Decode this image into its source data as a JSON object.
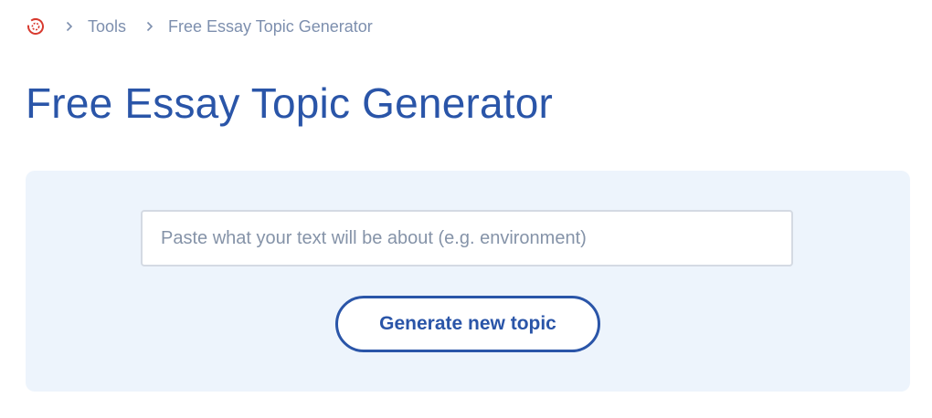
{
  "breadcrumb": {
    "home_icon": "home-logo-icon",
    "separator_icon": "chevron-right-icon",
    "items": [
      {
        "label": "Tools"
      },
      {
        "label": "Free Essay Topic Generator"
      }
    ]
  },
  "page": {
    "title": "Free Essay Topic Generator"
  },
  "form": {
    "input_placeholder": "Paste what your text will be about (e.g. environment)",
    "input_value": "",
    "button_label": "Generate new topic"
  },
  "colors": {
    "accent": "#2a55a8",
    "panel_background": "#edf4fc",
    "home_icon": "#d83a2f",
    "muted_text": "#7d8fae"
  }
}
